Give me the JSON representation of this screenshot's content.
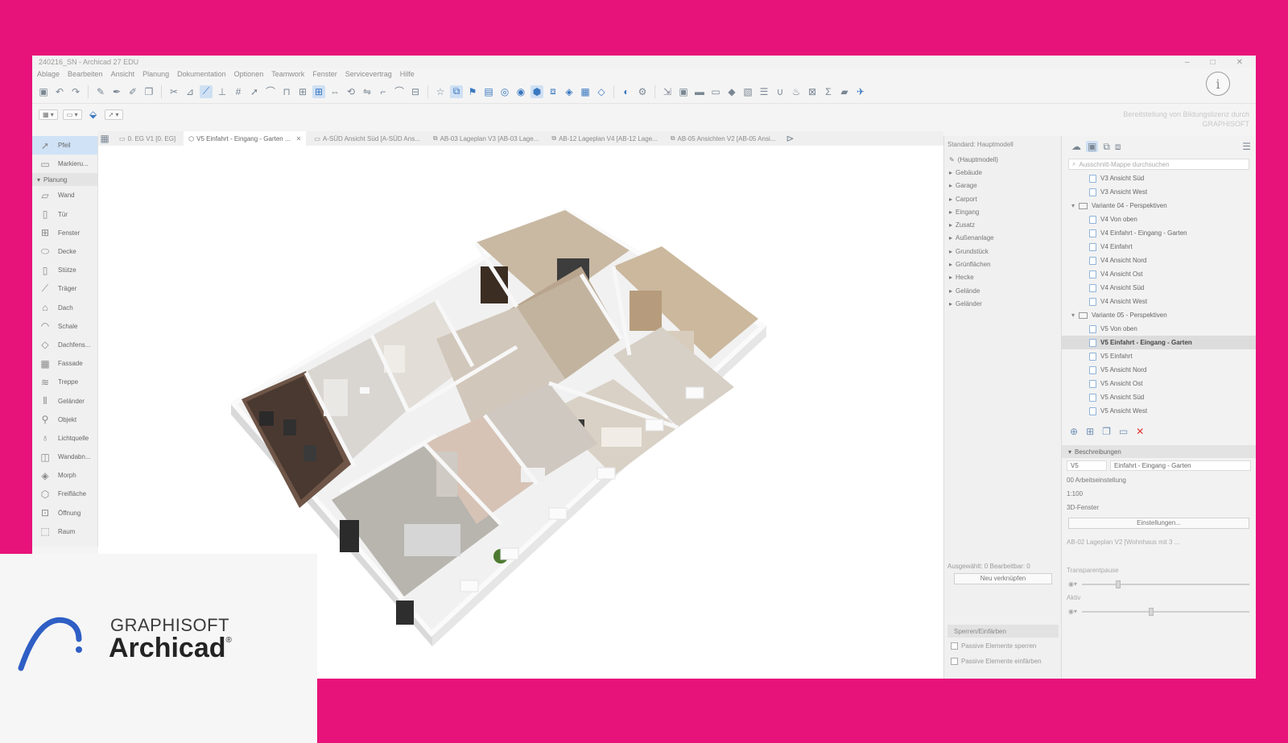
{
  "window": {
    "title": "240216_SN - Archicad 27 EDU"
  },
  "menu": [
    "Ablage",
    "Bearbeiten",
    "Ansicht",
    "Planung",
    "Dokumentation",
    "Optionen",
    "Teamwork",
    "Fenster",
    "Servicevertrag",
    "Hilfe"
  ],
  "license_note": "Bereitstellung von Bildungslizenz durch GRAPHISOFT",
  "tabs": [
    {
      "label": "0. EG V1 [0. EG]",
      "active": false
    },
    {
      "label": "V5 Einfahrt - Eingang - Garten ...",
      "active": true
    },
    {
      "label": "A-SÜD Ansicht Süd [A-SÜD Ans...",
      "active": false
    },
    {
      "label": "AB-03 Lageplan V3 [AB-03 Lage...",
      "active": false
    },
    {
      "label": "AB-12 Lageplan V4 [AB-12 Lage...",
      "active": false
    },
    {
      "label": "AB-05 Ansichten V2 [AB-05 Ansi...",
      "active": false
    }
  ],
  "toolbox": {
    "top": [
      {
        "label": "Pfeil",
        "icon": "arrow-icon"
      },
      {
        "label": "Markieru...",
        "icon": "marquee-icon"
      }
    ],
    "section": "Planung",
    "items": [
      {
        "label": "Wand",
        "icon": "wall-icon"
      },
      {
        "label": "Tür",
        "icon": "door-icon"
      },
      {
        "label": "Fenster",
        "icon": "window-icon"
      },
      {
        "label": "Decke",
        "icon": "slab-icon"
      },
      {
        "label": "Stütze",
        "icon": "column-icon"
      },
      {
        "label": "Träger",
        "icon": "beam-icon"
      },
      {
        "label": "Dach",
        "icon": "roof-icon"
      },
      {
        "label": "Schale",
        "icon": "shell-icon"
      },
      {
        "label": "Dachfens...",
        "icon": "skylight-icon"
      },
      {
        "label": "Fassade",
        "icon": "curtain-wall-icon"
      },
      {
        "label": "Treppe",
        "icon": "stair-icon"
      },
      {
        "label": "Geländer",
        "icon": "railing-icon"
      },
      {
        "label": "Objekt",
        "icon": "object-icon"
      },
      {
        "label": "Lichtquelle",
        "icon": "lamp-icon"
      },
      {
        "label": "Wandabn...",
        "icon": "wall-end-icon"
      },
      {
        "label": "Morph",
        "icon": "morph-icon"
      },
      {
        "label": "Freifläche",
        "icon": "zone-icon"
      },
      {
        "label": "Öffnung",
        "icon": "opening-icon"
      },
      {
        "label": "Raum",
        "icon": "room-icon"
      }
    ]
  },
  "navigator": {
    "header": "Standard: Hauptmodell",
    "root": "(Hauptmodell)",
    "items": [
      "Gebäude",
      "Garage",
      "Carport",
      "Eingang",
      "Zusatz",
      "Außenanlage",
      "Grundstück",
      "Grünflächen",
      "Hecke",
      "Gelände",
      "Geländer"
    ],
    "status": "Ausgewählt: 0 Bearbeitbar: 0",
    "new_button": "Neu verknüpfen",
    "section": "Sperren/Einfärben",
    "check1": "Passive Elemente sperren",
    "check2": "Passive Elemente einfärben"
  },
  "viewmap": {
    "search_placeholder": "Ausschnitt-Mappe durchsuchen",
    "rows": [
      {
        "label": "V3 Ansicht Süd",
        "type": "view",
        "indent": 1
      },
      {
        "label": "V3 Ansicht West",
        "type": "view",
        "indent": 1
      },
      {
        "label": "Variante 04 - Perspektiven",
        "type": "folder",
        "indent": 0
      },
      {
        "label": "V4 Von oben",
        "type": "view",
        "indent": 1
      },
      {
        "label": "V4 Einfahrt - Eingang - Garten",
        "type": "view",
        "indent": 1
      },
      {
        "label": "V4 Einfahrt",
        "type": "view",
        "indent": 1
      },
      {
        "label": "V4 Ansicht Nord",
        "type": "view",
        "indent": 1
      },
      {
        "label": "V4 Ansicht Ost",
        "type": "view",
        "indent": 1
      },
      {
        "label": "V4 Ansicht Süd",
        "type": "view",
        "indent": 1
      },
      {
        "label": "V4 Ansicht West",
        "type": "view",
        "indent": 1
      },
      {
        "label": "Variante 05 - Perspektiven",
        "type": "folder",
        "indent": 0
      },
      {
        "label": "V5 Von oben",
        "type": "view",
        "indent": 1
      },
      {
        "label": "V5 Einfahrt - Eingang - Garten",
        "type": "view",
        "indent": 1,
        "selected": true
      },
      {
        "label": "V5 Einfahrt",
        "type": "view",
        "indent": 1
      },
      {
        "label": "V5 Ansicht Nord",
        "type": "view",
        "indent": 1
      },
      {
        "label": "V5 Ansicht Ost",
        "type": "view",
        "indent": 1
      },
      {
        "label": "V5 Ansicht Süd",
        "type": "view",
        "indent": 1
      },
      {
        "label": "V5 Ansicht West",
        "type": "view",
        "indent": 1
      }
    ],
    "section": "Beschreibungen",
    "id_value": "V5",
    "name_value": "Einfahrt - Eingang - Garten",
    "setting_line": "00 Arbeitseinstellung",
    "scale_line": "1:100",
    "window_line": "3D-Fenster",
    "settings_button": "Einstellungen...",
    "linked_item": "AB-02 Lageplan V2 [Wohnhaus mit 3 ...",
    "transparency_label": "Transparentpause",
    "active_label": "Aktiv"
  },
  "logo": {
    "line1": "GRAPHISOFT",
    "line2": "Archicad",
    "reg": "®"
  },
  "colors": {
    "background": "#e8137a",
    "accent": "#3a78c0",
    "logo_blue": "#2f5fc5"
  }
}
